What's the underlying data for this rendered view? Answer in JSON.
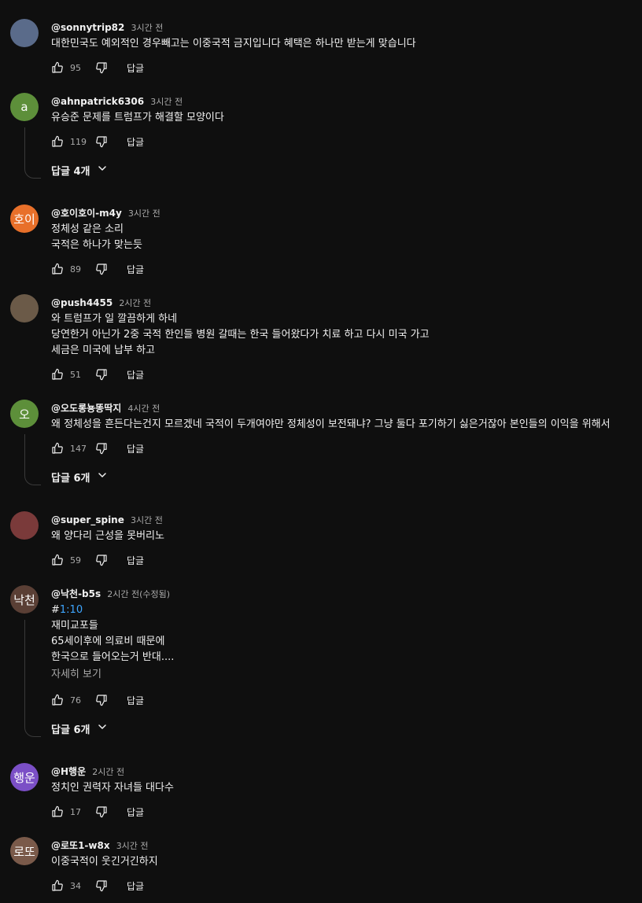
{
  "reply_label": "답글",
  "more_label": "자세히 보기",
  "comments": [
    {
      "author": "@sonnytrip82",
      "time": "3시간 전",
      "lines": [
        "대한민국도 예외적인 경우빼고는  이중국적 금지입니다 혜택은 하나만 받는게 맞습니다"
      ],
      "likes": "95",
      "avatar_text": "",
      "avatar_color": "#5a6b8a"
    },
    {
      "author": "@ahnpatrick6306",
      "time": "3시간 전",
      "lines": [
        "유승준 문제를 트럼프가 해결할 모양이다"
      ],
      "likes": "119",
      "avatar_text": "a",
      "avatar_color": "#5d8f3a",
      "replies": "답글 4개"
    },
    {
      "author": "@호이호이-m4y",
      "time": "3시간 전",
      "lines": [
        "정체성 같은 소리",
        "국적은 하나가 맞는듯"
      ],
      "likes": "89",
      "avatar_text": "호이",
      "avatar_color": "#e8702a"
    },
    {
      "author": "@push4455",
      "time": "2시간 전",
      "lines": [
        "와 트럼프가 일 깔끔하게 하네",
        "당연한거 아닌가 2중 국적 한인들 병원 갈때는 한국 들어왔다가 치료 하고 다시 미국 가고",
        "세금은 미국에 납부 하고"
      ],
      "likes": "51",
      "avatar_text": "",
      "avatar_color": "#6b5a48"
    },
    {
      "author": "@오도롱뇽똥딱지",
      "time": "4시간 전",
      "lines": [
        "왜 정체성을 흔든다는건지 모르겠네 국적이 두개여야만 정체성이 보전돼냐? 그냥 둘다 포기하기 싫은거잖아 본인들의 이익을 위해서"
      ],
      "likes": "147",
      "avatar_text": "오",
      "avatar_color": "#5d8f3a",
      "replies": "답글 6개"
    },
    {
      "author": "@super_spine",
      "time": "3시간 전",
      "lines": [
        "왜 양다리 근성을 못버리노"
      ],
      "likes": "59",
      "avatar_text": "",
      "avatar_color": "#7a3a3a"
    },
    {
      "author": "@낙천-b5s",
      "time": "2시간 전(수정됨)",
      "timestamp_prefix": "#",
      "timestamp": "1:10",
      "lines": [
        "재미교포들",
        "65세이후에 의료비 때문에",
        "한국으로 들어오는거 반대...."
      ],
      "show_more": true,
      "likes": "76",
      "avatar_text": "낙천",
      "avatar_color": "#5a3f35",
      "replies": "답글 6개"
    },
    {
      "author": "@H행운",
      "time": "2시간 전",
      "lines": [
        "정치인 권력자 자녀들 대다수"
      ],
      "likes": "17",
      "avatar_text": "행운",
      "avatar_color": "#7b4fc6"
    },
    {
      "author": "@로또1-w8x",
      "time": "3시간 전",
      "lines": [
        "이중국적이 웃긴거긴하지"
      ],
      "likes": "34",
      "avatar_text": "로또",
      "avatar_color": "#7a5a4a"
    }
  ]
}
